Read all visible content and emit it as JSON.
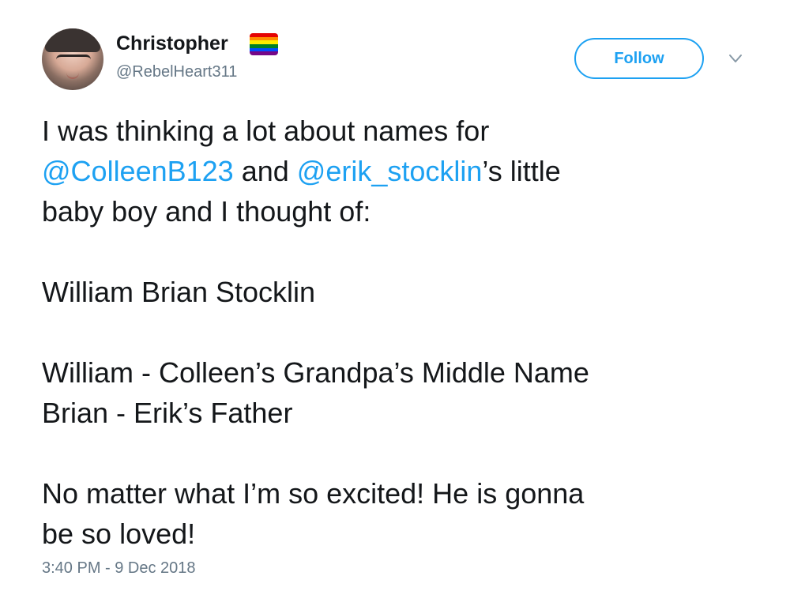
{
  "user": {
    "display_name": "Christopher",
    "handle": "@RebelHeart311",
    "badge_icon": "rainbow-flag-icon",
    "badge_colors": [
      "#e40303",
      "#ff8c00",
      "#ffed00",
      "#008026",
      "#004dff",
      "#750787"
    ]
  },
  "actions": {
    "follow_label": "Follow",
    "menu_icon": "chevron-down-icon"
  },
  "tweet": {
    "line1": "I was thinking a lot about names for",
    "mention1": "@ColleenB123",
    "line2_and": " and ",
    "mention2": "@erik_stocklin",
    "line2_tail": "’s little",
    "line3": "baby boy and I thought of:",
    "line4": "William Brian Stocklin",
    "line5": "William - Colleen’s Grandpa’s Middle Name",
    "line6": "Brian - Erik’s Father",
    "line7": "No matter what I’m so excited! He is gonna",
    "line8": "be so loved!"
  },
  "timestamp": "3:40 PM - 9 Dec 2018",
  "colors": {
    "accent": "#1da1f2",
    "text": "#14171a",
    "secondary": "#657786"
  }
}
